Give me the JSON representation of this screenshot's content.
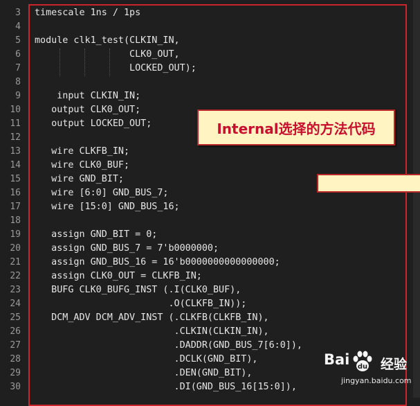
{
  "lines": [
    {
      "num": "3",
      "text": "timescale 1ns / 1ps"
    },
    {
      "num": "4",
      "text": ""
    },
    {
      "num": "5",
      "text": "module clk1_test(CLKIN_IN,"
    },
    {
      "num": "6",
      "text": "                 CLK0_OUT,"
    },
    {
      "num": "7",
      "text": "                 LOCKED_OUT);"
    },
    {
      "num": "8",
      "text": ""
    },
    {
      "num": "9",
      "text": "    input CLKIN_IN;"
    },
    {
      "num": "10",
      "text": "   output CLK0_OUT;"
    },
    {
      "num": "11",
      "text": "   output LOCKED_OUT;"
    },
    {
      "num": "12",
      "text": ""
    },
    {
      "num": "13",
      "text": "   wire CLKFB_IN;"
    },
    {
      "num": "14",
      "text": "   wire CLK0_BUF;"
    },
    {
      "num": "15",
      "text": "   wire GND_BIT;"
    },
    {
      "num": "16",
      "text": "   wire [6:0] GND_BUS_7;"
    },
    {
      "num": "17",
      "text": "   wire [15:0] GND_BUS_16;"
    },
    {
      "num": "18",
      "text": ""
    },
    {
      "num": "19",
      "text": "   assign GND_BIT = 0;"
    },
    {
      "num": "20",
      "text": "   assign GND_BUS_7 = 7'b0000000;"
    },
    {
      "num": "21",
      "text": "   assign GND_BUS_16 = 16'b0000000000000000;"
    },
    {
      "num": "22",
      "text": "   assign CLK0_OUT = CLKFB_IN;"
    },
    {
      "num": "23",
      "text": "   BUFG CLK0_BUFG_INST (.I(CLK0_BUF),"
    },
    {
      "num": "24",
      "text": "                        .O(CLKFB_IN));"
    },
    {
      "num": "25",
      "text": "   DCM_ADV DCM_ADV_INST (.CLKFB(CLKFB_IN),"
    },
    {
      "num": "26",
      "text": "                         .CLKIN(CLKIN_IN),"
    },
    {
      "num": "27",
      "text": "                         .DADDR(GND_BUS_7[6:0]),"
    },
    {
      "num": "28",
      "text": "                         .DCLK(GND_BIT),"
    },
    {
      "num": "29",
      "text": "                         .DEN(GND_BIT),"
    },
    {
      "num": "30",
      "text": "                         .DI(GND_BUS_16[15:0]),"
    }
  ],
  "callout": {
    "text": "Internal选择的方法代码"
  },
  "watermark": {
    "logo": "Bai",
    "brand": "经验",
    "url": "jingyan.baidu.com"
  }
}
